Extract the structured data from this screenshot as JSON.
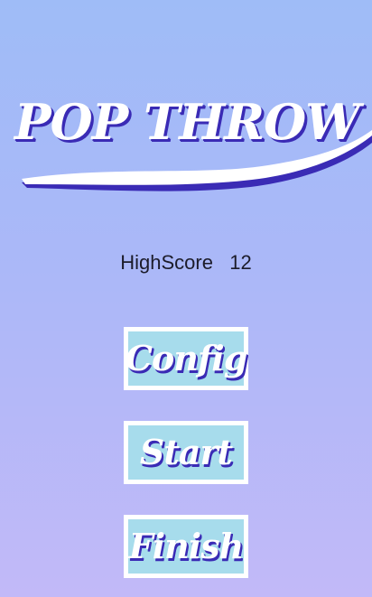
{
  "title": "POP THROW",
  "highscore": {
    "label": "HighScore",
    "value": "12"
  },
  "menu": {
    "config_label": "Config",
    "start_label": "Start",
    "finish_label": "Finish"
  },
  "colors": {
    "background_top": "#9fbcf7",
    "background_bottom": "#c2b9f8",
    "title_text": "#ffffff",
    "title_outline": "#3a2bb5",
    "button_fill": "#a7dcec",
    "button_border": "#ffffff",
    "highscore_text": "#1c1c2a"
  }
}
